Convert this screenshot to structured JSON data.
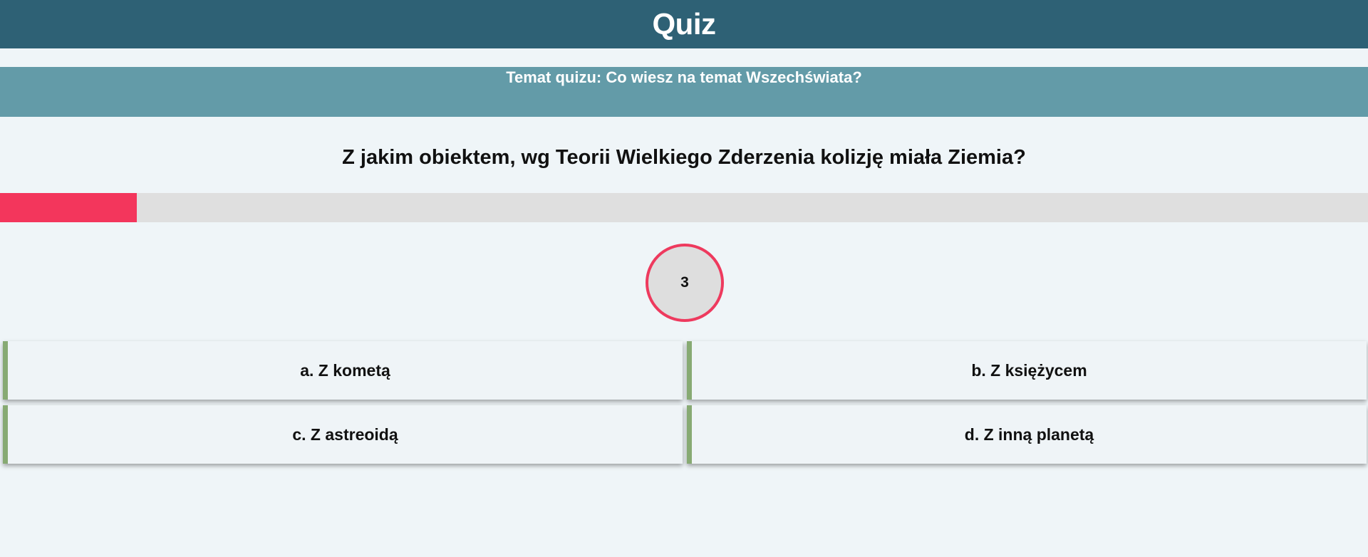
{
  "header": {
    "title": "Quiz"
  },
  "topic": {
    "text": "Temat quizu: Co wiesz na temat Wszechświata?"
  },
  "question": {
    "text": "Z jakim obiektem, wg Teorii Wielkiego Zderzenia kolizję miała Ziemia?"
  },
  "progress": {
    "fraction": 0.1,
    "color": "#f3365c"
  },
  "timer": {
    "value": "3"
  },
  "answers": [
    {
      "label": "a. Z kometą"
    },
    {
      "label": "b. Z księżycem"
    },
    {
      "label": "c. Z astreoidą"
    },
    {
      "label": "d. Z inną planetą"
    }
  ],
  "colors": {
    "header_bg": "#2e6175",
    "topic_bg": "#639ba8",
    "answer_accent": "#87aa73",
    "timer_ring": "#ee3a5e"
  }
}
